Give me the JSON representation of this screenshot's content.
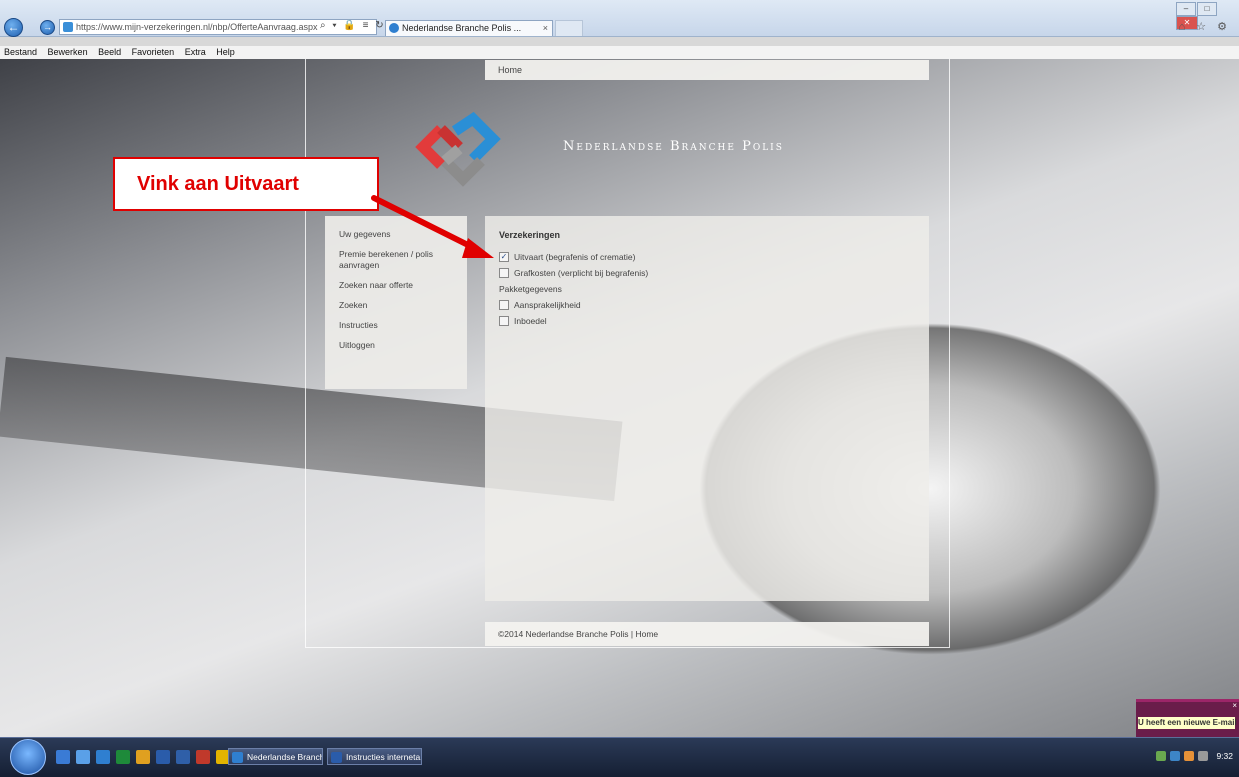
{
  "browser": {
    "url": "https://www.mijn-verzekeringen.nl/nbp/OfferteAanvraag.aspx",
    "tab_title": "Nederlandse Branche Polis ...",
    "tab_close": "×",
    "address_tools": "⌕ ▾ 🔒 ≡ ↻ ✕",
    "right_icons": "⌂ ☆ ⚙",
    "menu": [
      "Bestand",
      "Bewerken",
      "Beeld",
      "Favorieten",
      "Extra",
      "Help"
    ]
  },
  "site": {
    "top_nav": "Home",
    "brand": "Nederlandse Branche Polis",
    "side_menu": [
      "Uw gegevens",
      "Premie berekenen / polis aanvragen",
      "Zoeken naar offerte",
      "Zoeken",
      "Instructies",
      "Uitloggen"
    ],
    "content": {
      "heading": "Verzekeringen",
      "options": [
        {
          "label": "Uitvaart (begrafenis of crematie)",
          "checked": true
        },
        {
          "label": "Grafkosten (verplicht bij begrafenis)",
          "checked": false
        }
      ],
      "subheading": "Pakketgegevens",
      "packages": [
        {
          "label": "Aansprakelijkheid",
          "checked": false
        },
        {
          "label": "Inboedel",
          "checked": false
        }
      ]
    },
    "footer": "©2014 Nederlandse Branche Polis | Home"
  },
  "annotation": {
    "text": "Vink aan Uitvaart",
    "color": "#e00000"
  },
  "notification": {
    "text": "U heeft een nieuwe E-mail",
    "close": "×"
  },
  "taskbar": {
    "tasks": [
      "Nederlandse Branch...",
      "Instructies interneta..."
    ],
    "clock": "9:32"
  }
}
